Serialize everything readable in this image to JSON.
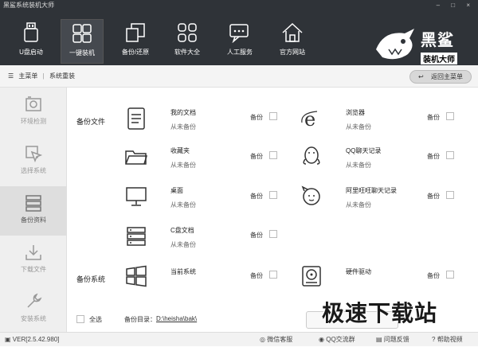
{
  "window": {
    "title": "黑鲨系统装机大师",
    "controls": "– □ ×"
  },
  "nav": {
    "items": [
      {
        "label": "U盘启动",
        "icon": "usb-icon"
      },
      {
        "label": "一键装机",
        "icon": "windows-icon",
        "active": true
      },
      {
        "label": "备份/还原",
        "icon": "backup-icon"
      },
      {
        "label": "软件大全",
        "icon": "apps-icon"
      },
      {
        "label": "人工服务",
        "icon": "chat-icon"
      },
      {
        "label": "官方网站",
        "icon": "home-icon"
      }
    ]
  },
  "logo": {
    "text1": "黑鲨",
    "text2": "装机大师"
  },
  "breadcrumb": {
    "home": "主菜单",
    "current": "系统重装",
    "back_label": "返回主菜单"
  },
  "sidebar": {
    "items": [
      {
        "label": "环境检测"
      },
      {
        "label": "选择系统"
      },
      {
        "label": "备份资料",
        "active": true
      },
      {
        "label": "下载文件"
      },
      {
        "label": "安装系统"
      }
    ]
  },
  "backup_files": {
    "section_label": "备份文件",
    "backup_word": "备份",
    "items": [
      {
        "title": "我的文档",
        "sub": "从未备份"
      },
      {
        "title": "浏览器",
        "sub": "从未备份"
      },
      {
        "title": "收藏夹",
        "sub": "从未备份"
      },
      {
        "title": "QQ聊天记录",
        "sub": "从未备份"
      },
      {
        "title": "桌面",
        "sub": "从未备份"
      },
      {
        "title": "阿里旺旺聊天记录",
        "sub": "从未备份"
      },
      {
        "title": "C盘文档",
        "sub": "从未备份"
      }
    ]
  },
  "backup_system": {
    "section_label": "备份系统",
    "items": [
      {
        "title": "当前系统"
      },
      {
        "title": "硬件驱动"
      }
    ]
  },
  "bottom": {
    "select_all": "全选",
    "dir_label": "备份目录：",
    "dir_path": "D:\\heisha\\bak\\"
  },
  "status": {
    "version": "VER[2.5.42.980]",
    "wechat": "微信客服",
    "qq": "QQ交流群",
    "feedback": "问题反馈",
    "help": "帮助视频"
  },
  "watermark": "极速下载站",
  "colors": {
    "topbar": "#2f3338",
    "sidebar": "#efefef",
    "sidebar_active": "#dedede"
  }
}
